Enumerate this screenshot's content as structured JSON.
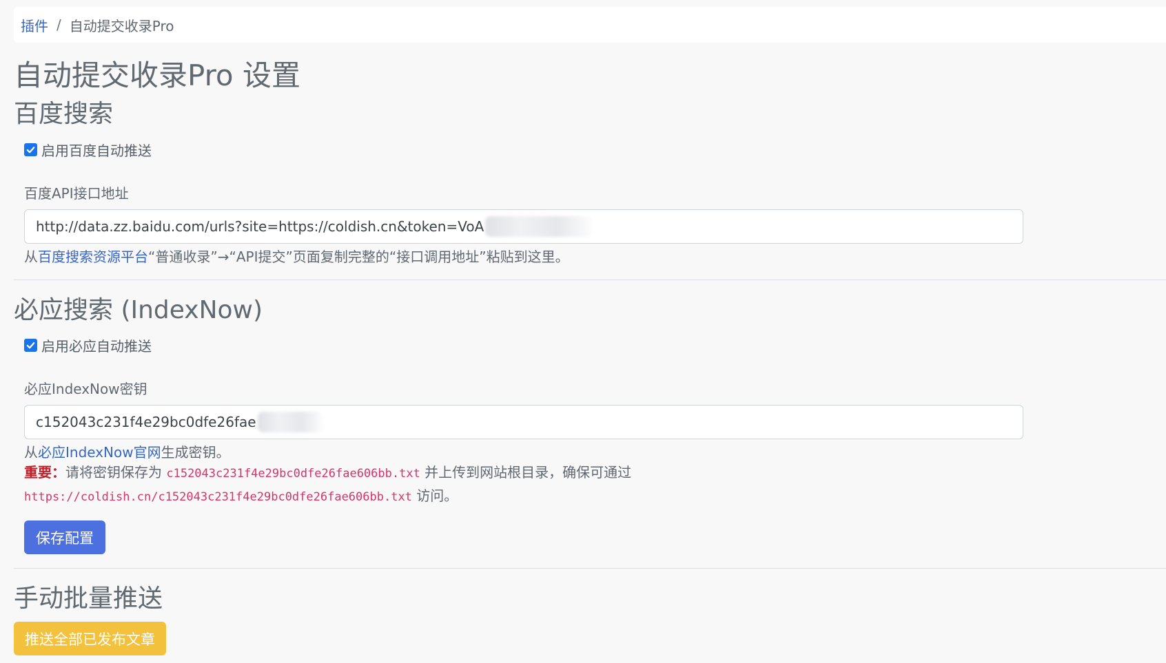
{
  "breadcrumb": {
    "parent": "插件",
    "separator": "/",
    "current": "自动提交收录Pro"
  },
  "page_title": "自动提交收录Pro 设置",
  "baidu": {
    "heading": "百度搜索",
    "enable_label": "启用百度自动推送",
    "enabled": true,
    "api_label": "百度API接口地址",
    "api_value": "http://data.zz.baidu.com/urls?site=https://coldish.cn&token=VoA",
    "help_prefix": "从",
    "help_link": "百度搜索资源平台",
    "help_suffix": "“普通收录”→“API提交”页面复制完整的“接口调用地址”粘贴到这里。"
  },
  "bing": {
    "heading": "必应搜索 (IndexNow)",
    "enable_label": "启用必应自动推送",
    "enabled": true,
    "key_label": "必应IndexNow密钥",
    "key_value": "c152043c231f4e29bc0dfe26fae",
    "help_prefix": "从",
    "help_link": "必应IndexNow官网",
    "help_suffix": "生成密钥。",
    "important_label": "重要：",
    "important_text_1": "请将密钥保存为 ",
    "key_filename": "c152043c231f4e29bc0dfe26fae606bb.txt",
    "important_text_2": " 并上传到网站根目录，确保可通过",
    "key_url": "https://coldish.cn/c152043c231f4e29bc0dfe26fae606bb.txt",
    "important_text_3": " 访问。"
  },
  "save_button": "保存配置",
  "manual": {
    "heading": "手动批量推送",
    "push_all_button": "推送全部已发布文章"
  },
  "colors": {
    "link": "#3566c4",
    "primary": "#4c70e0",
    "warning": "#f4c13c",
    "danger": "#c0202a",
    "code": "#d6336c",
    "checkbox": "#1a73e8"
  }
}
